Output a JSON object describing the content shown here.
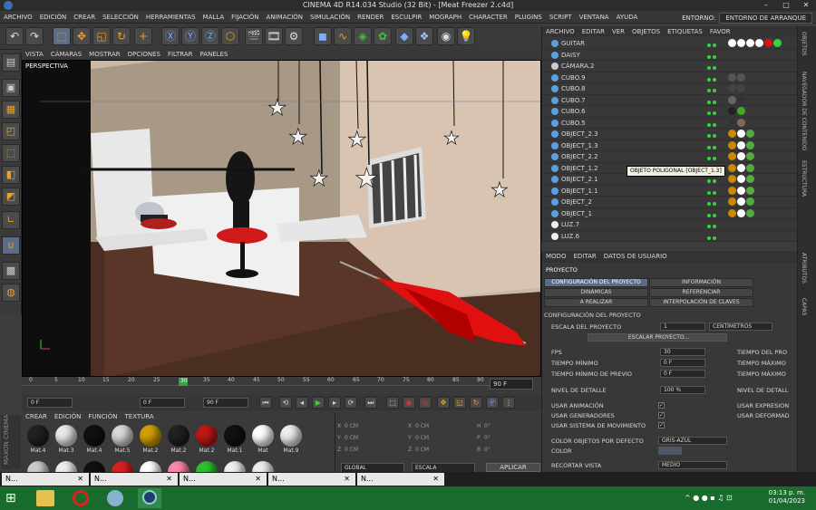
{
  "window": {
    "title": "CINEMA 4D R14.034 Studio (32 Bit) - [Meat Freezer 2.c4d]",
    "minimize": "–",
    "maximize": "□",
    "close": "✕"
  },
  "menubar": {
    "items": [
      "Archivo",
      "Edición",
      "Crear",
      "Selección",
      "Herramientas",
      "Malla",
      "Fijación",
      "Animación",
      "Simulación",
      "Render",
      "Esculpir",
      "MoGraph",
      "Character",
      "Plugins",
      "Script",
      "Ventana",
      "Ayuda"
    ],
    "env_label": "Entorno:",
    "env_value": "Entorno de arranque"
  },
  "viewport": {
    "menu": [
      "Vista",
      "Cámaras",
      "Mostrar",
      "Opciones",
      "Filtrar",
      "Paneles"
    ],
    "label": "Perspectiva"
  },
  "timeline": {
    "ticks": [
      "0",
      "5",
      "10",
      "15",
      "20",
      "25",
      "30",
      "35",
      "40",
      "45",
      "50",
      "55",
      "60",
      "65",
      "70",
      "75",
      "80",
      "85",
      "90"
    ],
    "current_frame": "30",
    "end_frame": "90 F"
  },
  "transport": {
    "start": "0 F",
    "min": "0 F",
    "max": "90 F"
  },
  "materials": {
    "menu": [
      "Crear",
      "Edición",
      "Función",
      "Textura"
    ],
    "items": [
      {
        "name": "Mat.4",
        "color": "#222222"
      },
      {
        "name": "Mat.3",
        "color": "#e8e8e8"
      },
      {
        "name": "Mat.4",
        "color": "#111111"
      },
      {
        "name": "Mat.5",
        "color": "#d8d8d8"
      },
      {
        "name": "Mat.2",
        "color": "#d4a000"
      },
      {
        "name": "Mat.2",
        "color": "#222222"
      },
      {
        "name": "Mat.2",
        "color": "#c01818"
      },
      {
        "name": "Mat.1",
        "color": "#111111"
      },
      {
        "name": "Mat",
        "color": "#ffffff"
      },
      {
        "name": "Mat.9",
        "color": "#eeeeee"
      }
    ],
    "row2": [
      {
        "color": "#cccccc"
      },
      {
        "color": "#eeeeee"
      },
      {
        "color": "#111111"
      },
      {
        "color": "#d82020"
      },
      {
        "color": "#ffffff"
      },
      {
        "color": "#ff88aa"
      },
      {
        "color": "#30c030"
      },
      {
        "color": "#f0f0f0"
      },
      {
        "color": "#eeeeee"
      }
    ]
  },
  "coords": {
    "rows": [
      {
        "axis": "X",
        "val": "0 cm",
        "axis2": "X",
        "val2": "0 cm",
        "axis3": "H",
        "val3": "0°"
      },
      {
        "axis": "Y",
        "val": "0 cm",
        "axis2": "Y",
        "val2": "0 cm",
        "axis3": "P",
        "val3": "0°"
      },
      {
        "axis": "Z",
        "val": "0 cm",
        "axis2": "Z",
        "val2": "0 cm",
        "axis3": "B",
        "val3": "0°"
      }
    ],
    "mode1": "Global",
    "mode2": "Escala",
    "apply": "Aplicar"
  },
  "objects": {
    "menu": [
      "Archivo",
      "Editar",
      "Ver",
      "Objetos",
      "Etiquetas",
      "Favor"
    ],
    "rows": [
      "Guitar",
      "Daisy",
      "Cámara.2",
      "Cubo.9",
      "Cubo.8",
      "Cubo.7",
      "Cubo.6",
      "Cubo.5",
      "Object_2.3",
      "Object_1.3",
      "Object_2.2",
      "Object_1.2",
      "Object_2.1",
      "Object_1.1",
      "Object_2",
      "Object_1",
      "Luz.7",
      "Luz.6"
    ],
    "tooltip": "Objeto Poligonal [Object_1.3]"
  },
  "attributes": {
    "menu": [
      "Modo",
      "Editar",
      "Datos de Usuario"
    ],
    "section": "Proyecto",
    "tabs": [
      "Configuración del Proyecto",
      "Información",
      "Dinámicas",
      "Referenciar",
      "A Realizar",
      "Interpolación de Claves"
    ],
    "header": "Configuración del Proyecto",
    "escala_label": "Escala del Proyecto",
    "escala_val": "1",
    "escala_unit": "Centímetros",
    "escalar_btn": "Escalar Proyecto...",
    "fps_label": "FPS",
    "fps_val": "30",
    "tmin_label": "Tiempo Mínimo",
    "tmin_val": "0 F",
    "tprev_label": "Tiempo Mínimo de Previo",
    "tprev_val": "0 F",
    "detalle_label": "Nivel de Detalle",
    "detalle_val": "100 %",
    "tproy": "Tiempo del Pro",
    "tmax": "Tiempo Máximo",
    "tmax2": "Tiempo Máximo",
    "ndet2": "Nivel de Detall",
    "usar_anim": "Usar Animación",
    "usar_gen": "Usar Generadores",
    "usar_mov": "Usar Sistema de Movimiento",
    "usar_expr": "Usar Expresion",
    "usar_def": "Usar Deformad",
    "color_obj_label": "Color Objetos por Defecto",
    "color_obj_val": "Gris-Azul",
    "color_label": "Color",
    "recortar_label": "Recortar Vista",
    "recortar_val": "Medio"
  },
  "rightstrip": [
    "Objetos",
    "Navegador de Contenido",
    "Estructura",
    "Atributos",
    "Capas"
  ],
  "taskbuttons": [
    "N...",
    "N...",
    "N...",
    "N...",
    "N..."
  ],
  "clock": {
    "time": "03:13 p. m.",
    "date": "01/04/2023"
  }
}
